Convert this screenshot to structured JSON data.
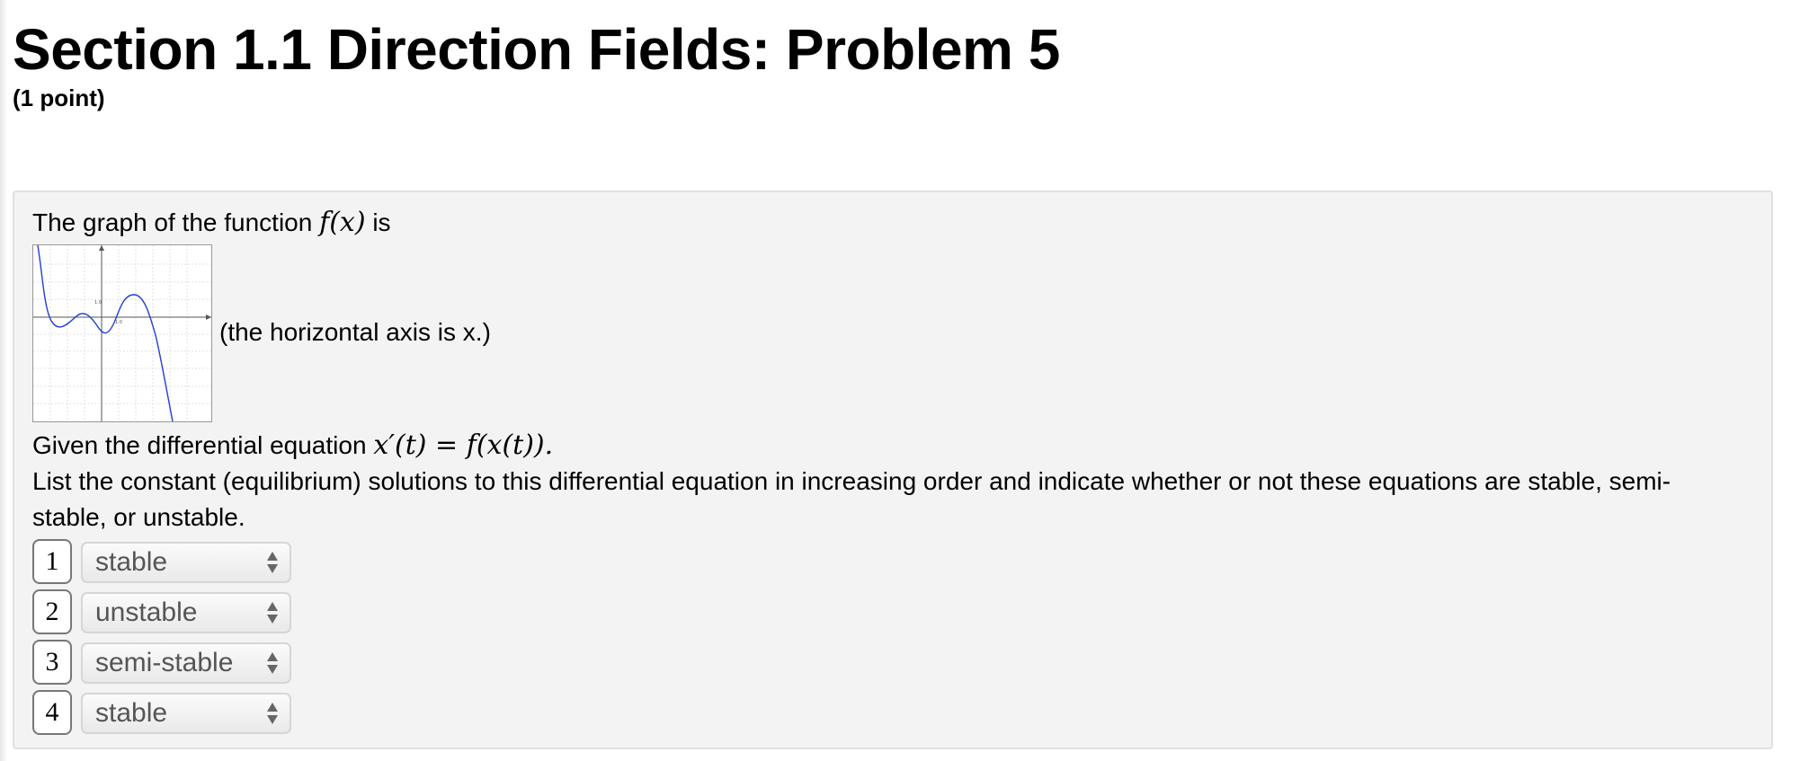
{
  "header": {
    "title": "Section 1.1 Direction Fields: Problem 5",
    "points": "(1 point)"
  },
  "problem": {
    "intro_text": "The graph of the function",
    "intro_math": "f(x)",
    "intro_suffix": "is",
    "graph_caption": "(the horizontal axis is x.)",
    "given_text": "Given the differential equation",
    "given_math": "x′(t) = f(x(t)).",
    "instruction_line1": "List the constant (equilibrium) solutions to this differential equation in increasing order and indicate whether or not these equations are stable, semi-",
    "instruction_line2": "stable, or unstable."
  },
  "graph": {
    "tick_label_y": "1.0",
    "tick_label_x": "1.0",
    "curve_color": "#1f3fd6"
  },
  "answers": [
    {
      "number": "1",
      "selection": "stable"
    },
    {
      "number": "2",
      "selection": "unstable"
    },
    {
      "number": "3",
      "selection": "semi-stable"
    },
    {
      "number": "4",
      "selection": "stable"
    }
  ]
}
